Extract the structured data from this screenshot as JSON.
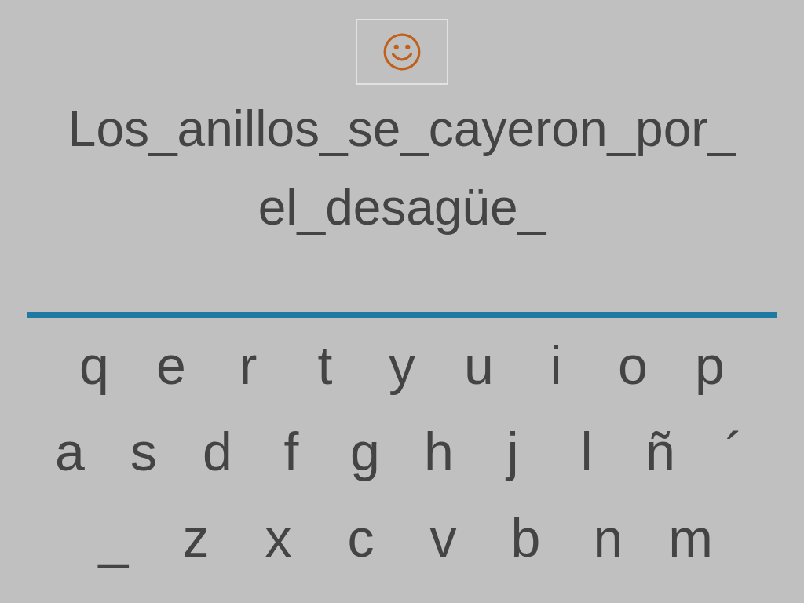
{
  "sentence_lines": [
    "Los_anillos_se_cayeron_por_",
    "el_desagüe_"
  ],
  "keyboard_rows": [
    [
      "q",
      "e",
      "r",
      "t",
      "y",
      "u",
      "i",
      "o",
      "p"
    ],
    [
      "a",
      "s",
      "d",
      "f",
      "g",
      "h",
      "j",
      "l",
      "ñ",
      "´"
    ],
    [
      "_",
      "z",
      "x",
      "c",
      "v",
      "b",
      "n",
      "m"
    ]
  ]
}
